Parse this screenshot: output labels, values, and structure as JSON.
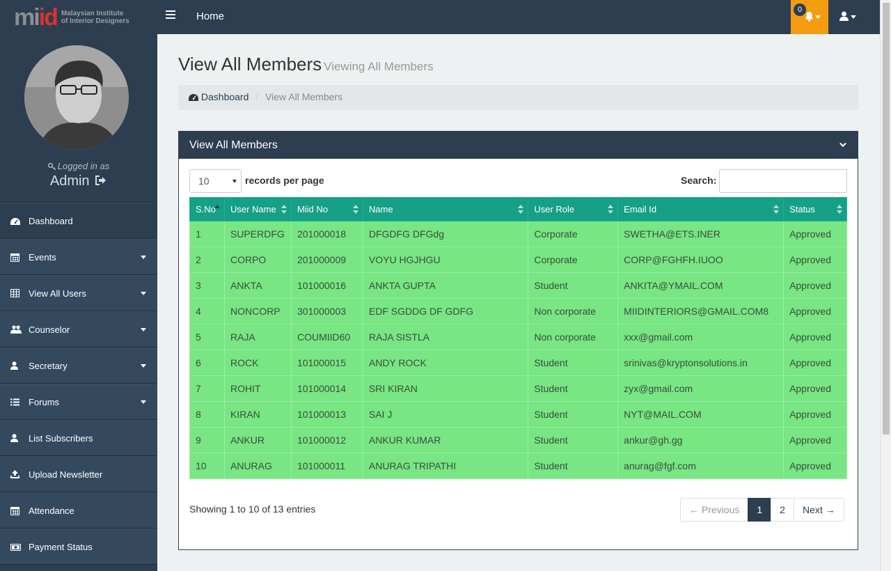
{
  "topbar": {
    "logo_mark_a": "mi",
    "logo_mark_b": "id",
    "logo_line1": "Malaysian Institute",
    "logo_line2": "of Interior Designers",
    "home_label": "Home",
    "notification_count": "0",
    "brand_color": "#2c3e50",
    "notif_color": "#f39c12"
  },
  "sidebar": {
    "logged_in_label": "Logged in as",
    "user_name": "Admin",
    "items": [
      {
        "label": "Dashboard",
        "icon": "dashboard-icon",
        "has_submenu": false
      },
      {
        "label": "Events",
        "icon": "calendar-icon",
        "has_submenu": true
      },
      {
        "label": "View All Users",
        "icon": "table-icon",
        "has_submenu": true
      },
      {
        "label": "Counselor",
        "icon": "users-icon",
        "has_submenu": true
      },
      {
        "label": "Secretary",
        "icon": "user-icon",
        "has_submenu": true
      },
      {
        "label": "Forums",
        "icon": "list-icon",
        "has_submenu": true
      },
      {
        "label": "List Subscribers",
        "icon": "user-icon",
        "has_submenu": false
      },
      {
        "label": "Upload Newsletter",
        "icon": "upload-icon",
        "has_submenu": false
      },
      {
        "label": "Attendance",
        "icon": "calendar-icon",
        "has_submenu": false
      },
      {
        "label": "Payment Status",
        "icon": "money-icon",
        "has_submenu": false
      }
    ]
  },
  "page": {
    "title": "View All Members",
    "subtitle": "Viewing All Members",
    "breadcrumb_home": "Dashboard",
    "breadcrumb_current": "View All Members"
  },
  "panel": {
    "title": "View All Members",
    "page_length": "10",
    "length_label": "records per page",
    "search_label": "Search:",
    "search_value": "",
    "columns": [
      "S.No",
      "User Name",
      "Miid No",
      "Name",
      "User Role",
      "Email Id",
      "Status"
    ],
    "rows": [
      [
        "1",
        "SUPERDFG",
        "201000018",
        "DFGDFG DFGdg",
        "Corporate",
        "SWETHA@ETS.INER",
        "Approved"
      ],
      [
        "2",
        "CORPO",
        "201000009",
        "VOYU HGJHGU",
        "Corporate",
        "CORP@FGHFH.IUOO",
        "Approved"
      ],
      [
        "3",
        "ANKTA",
        "101000016",
        "ANKTA GUPTA",
        "Student",
        "ANKITA@YMAIL.COM",
        "Approved"
      ],
      [
        "4",
        "NONCORP",
        "301000003",
        "EDF SGDDG DF GDFG",
        "Non corporate",
        "MIIDINTERIORS@GMAIL.COM8",
        "Approved"
      ],
      [
        "5",
        "RAJA",
        "COUMIID60",
        "RAJA SISTLA",
        "Non corporate",
        "xxx@gmail.com",
        "Approved"
      ],
      [
        "6",
        "ROCK",
        "101000015",
        "ANDY ROCK",
        "Student",
        "srinivas@kryptonsolutions.in",
        "Approved"
      ],
      [
        "7",
        "ROHIT",
        "101000014",
        "SRI KIRAN",
        "Student",
        "zyx@gmail.com",
        "Approved"
      ],
      [
        "8",
        "KIRAN",
        "101000013",
        "SAI J",
        "Student",
        "NYT@MAIL.COM",
        "Approved"
      ],
      [
        "9",
        "ANKUR",
        "101000012",
        "ANKUR KUMAR",
        "Student",
        "ankur@gh.gg",
        "Approved"
      ],
      [
        "10",
        "ANURAG",
        "101000011",
        "ANURAG TRIPATHI",
        "Student",
        "anurag@fgf.com",
        "Approved"
      ]
    ],
    "info": "Showing 1 to 10 of 13 entries",
    "pager": {
      "previous": "← Previous",
      "pages": [
        "1",
        "2"
      ],
      "current": "1",
      "next": "Next →"
    },
    "header_color": "#16a085",
    "row_color": "#77e683"
  }
}
